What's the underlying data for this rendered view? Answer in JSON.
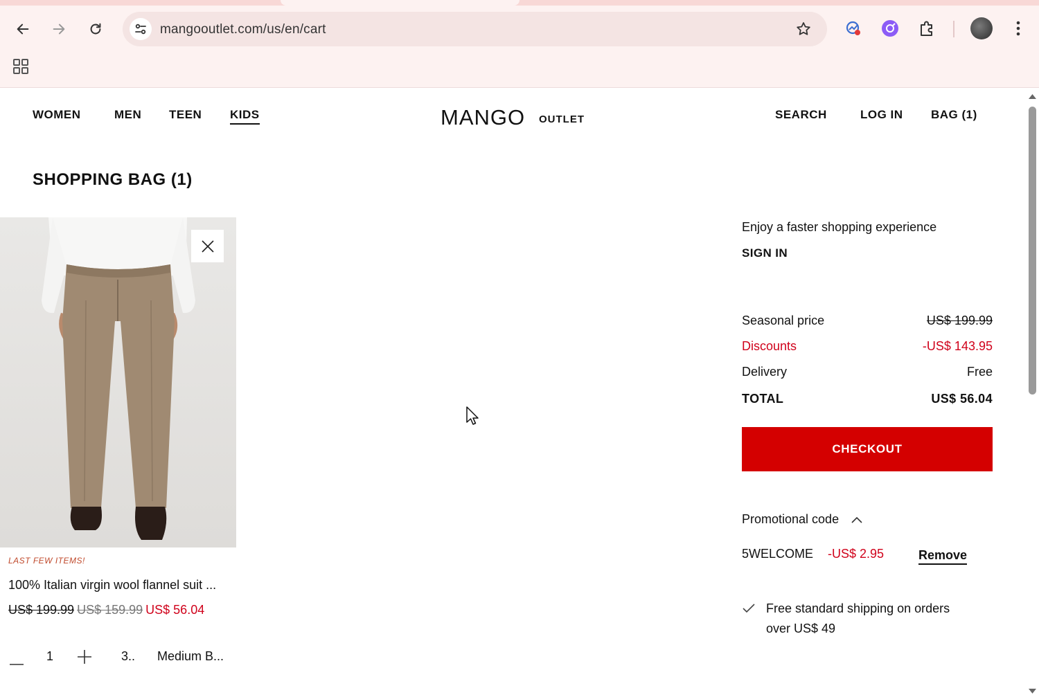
{
  "browser": {
    "url": "mangooutlet.com/us/en/cart"
  },
  "site": {
    "nav": [
      "WOMEN",
      "MEN",
      "TEEN",
      "KIDS"
    ],
    "logo": "MANGO",
    "logo_sub": "OUTLET",
    "right_nav": {
      "search": "SEARCH",
      "login": "LOG IN",
      "bag": "BAG (1)"
    }
  },
  "cart": {
    "title": "SHOPPING BAG (1)",
    "item": {
      "badge": "LAST FEW ITEMS!",
      "name": "100% Italian virgin wool flannel suit ...",
      "price_original": "US$ 199.99",
      "price_intermediate": "US$ 159.99",
      "price_current": "US$ 56.04",
      "quantity": "1",
      "size": "3..",
      "color": "Medium B..."
    }
  },
  "summary": {
    "signin_prompt": "Enjoy a faster shopping experience",
    "signin_link": "SIGN IN",
    "seasonal_label": "Seasonal price",
    "seasonal_value": "US$ 199.99",
    "discounts_label": "Discounts",
    "discounts_value": "-US$ 143.95",
    "delivery_label": "Delivery",
    "delivery_value": "Free",
    "total_label": "TOTAL",
    "total_value": "US$ 56.04",
    "checkout_label": "CHECKOUT",
    "promo_label": "Promotional code",
    "promo_code": "5WELCOME",
    "promo_discount": "-US$ 2.95",
    "promo_remove": "Remove",
    "shipping_line1": "Free standard shipping on orders",
    "shipping_line2": "over US$ 49"
  },
  "colors": {
    "accent_red": "#d40000",
    "price_red": "#d0021b",
    "badge_orange": "#c0492b"
  }
}
